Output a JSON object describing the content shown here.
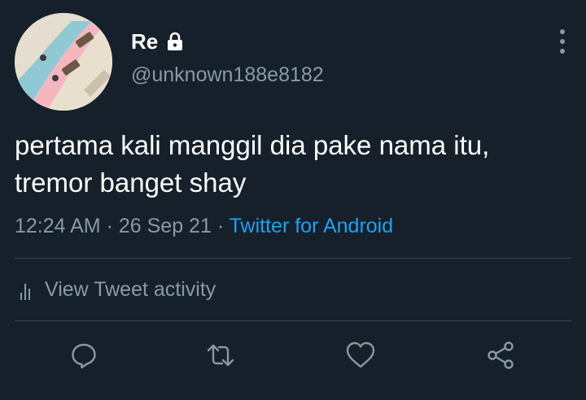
{
  "user": {
    "display_name": "Re",
    "handle": "@unknown188e8182",
    "protected_icon": "lock-icon",
    "avatar": "avatar-image"
  },
  "tweet": {
    "text_lines": [
      "pertama kali manggil dia pake nama itu,",
      "tremor banget shay"
    ],
    "time": "12:24 AM",
    "separator": "·",
    "date": "26 Sep 21",
    "source": "Twitter for Android"
  },
  "activity": {
    "label": "View Tweet activity",
    "icon": "bar-chart-icon"
  },
  "actions": {
    "reply_icon": "reply-icon",
    "retweet_icon": "retweet-icon",
    "like_icon": "like-icon",
    "share_icon": "share-icon",
    "more_icon": "more-options-icon"
  },
  "colors": {
    "background": "#15202b",
    "primary_text": "#ffffff",
    "secondary_text": "#8899a6",
    "link": "#1da1f2",
    "divider": "#38444d"
  }
}
